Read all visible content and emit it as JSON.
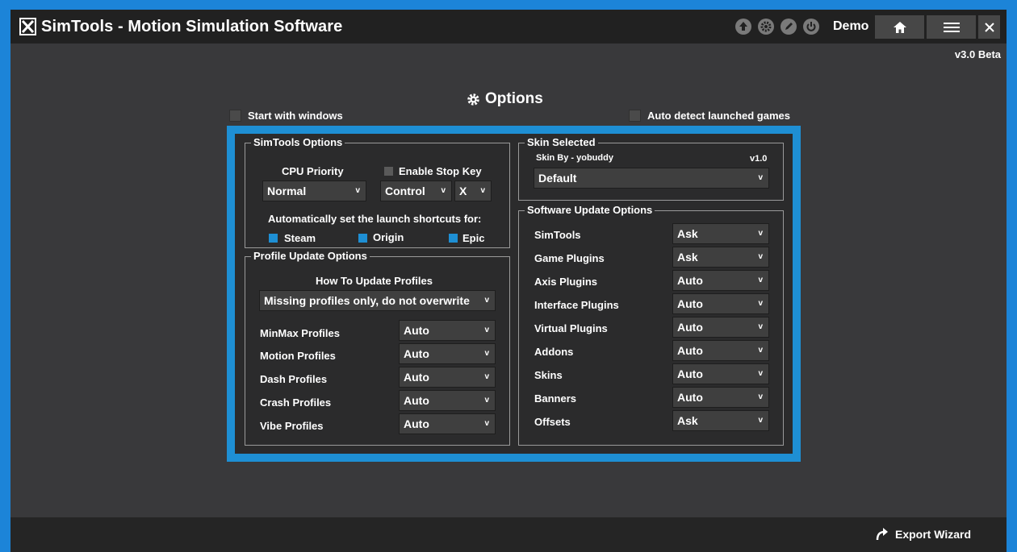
{
  "app": {
    "title": "SimTools - Motion Simulation Software",
    "user": "Demo",
    "version": "v3.0 Beta",
    "toolbar_icons": [
      "upload-icon",
      "settings-cog-icon",
      "edit-icon",
      "power-icon",
      "home-icon",
      "menu-icon",
      "close-icon"
    ]
  },
  "options": {
    "title": "Options",
    "start_with_windows": {
      "label": "Start with windows",
      "checked": false
    },
    "auto_detect": {
      "label": "Auto detect launched games",
      "checked": false
    }
  },
  "simtools_options": {
    "legend": "SimTools Options",
    "cpu_priority_label": "CPU Priority",
    "cpu_priority_value": "Normal",
    "enable_stop_key": {
      "label": "Enable Stop Key",
      "checked": false
    },
    "stop_key_modifier": "Control",
    "stop_key": "X",
    "shortcuts_label": "Automatically set the launch shortcuts for:",
    "shortcuts": [
      {
        "label": "Steam",
        "checked": true
      },
      {
        "label": "Origin",
        "checked": true
      },
      {
        "label": "Epic",
        "checked": true
      }
    ]
  },
  "profile_update": {
    "legend": "Profile Update Options",
    "how_label": "How To Update Profiles",
    "how_value": "Missing profiles only, do not overwrite",
    "rows": [
      {
        "label": "MinMax Profiles",
        "value": "Auto"
      },
      {
        "label": "Motion Profiles",
        "value": "Auto"
      },
      {
        "label": "Dash Profiles",
        "value": "Auto"
      },
      {
        "label": "Crash Profiles",
        "value": "Auto"
      },
      {
        "label": "Vibe Profiles",
        "value": "Auto"
      }
    ]
  },
  "skin": {
    "legend": "Skin Selected",
    "author": "Skin By - yobuddy",
    "version": "v1.0",
    "value": "Default"
  },
  "software_update": {
    "legend": "Software Update Options",
    "rows": [
      {
        "label": "SimTools",
        "value": "Ask"
      },
      {
        "label": "Game Plugins",
        "value": "Ask"
      },
      {
        "label": "Axis Plugins",
        "value": "Auto"
      },
      {
        "label": "Interface Plugins",
        "value": "Auto"
      },
      {
        "label": "Virtual Plugins",
        "value": "Auto"
      },
      {
        "label": "Addons",
        "value": "Auto"
      },
      {
        "label": "Skins",
        "value": "Auto"
      },
      {
        "label": "Banners",
        "value": "Auto"
      },
      {
        "label": "Offsets",
        "value": "Ask"
      }
    ]
  },
  "footer": {
    "export_label": "Export Wizard"
  },
  "colors": {
    "accent": "#1e8fd4",
    "panel": "#2b2b2c",
    "background": "#39393b",
    "titlebar": "#212121"
  }
}
